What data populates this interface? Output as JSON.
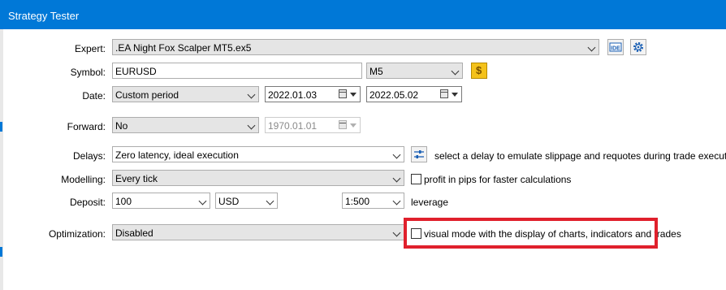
{
  "window": {
    "title": "Strategy Tester"
  },
  "expert": {
    "label": "Expert:",
    "value": ".EA Night Fox Scalper MT5.ex5",
    "ide_label": "IDE"
  },
  "symbol": {
    "label": "Symbol:",
    "value": "EURUSD",
    "timeframe": "M5",
    "spec_icon": "dollar-icon"
  },
  "date": {
    "label": "Date:",
    "mode": "Custom period",
    "from": "2022.01.03",
    "to": "2022.05.02"
  },
  "forward": {
    "label": "Forward:",
    "value": "No",
    "date": "1970.01.01"
  },
  "delays": {
    "label": "Delays:",
    "value": "Zero latency, ideal execution",
    "hint": "select a delay to emulate slippage and requotes during trade execution"
  },
  "modelling": {
    "label": "Modelling:",
    "value": "Every tick",
    "pips_option": "profit in pips for faster calculations",
    "pips_checked": false
  },
  "deposit": {
    "label": "Deposit:",
    "amount": "100",
    "currency": "USD",
    "leverage": "1:500",
    "leverage_label": "leverage"
  },
  "optimization": {
    "label": "Optimization:",
    "value": "Disabled",
    "visual_option": "visual mode with the display of charts, indicators and trades",
    "visual_checked": false
  },
  "colors": {
    "titlebar": "#0078d7",
    "highlight": "#e0202c",
    "dollar_icon_bg": "#f4c21b"
  }
}
